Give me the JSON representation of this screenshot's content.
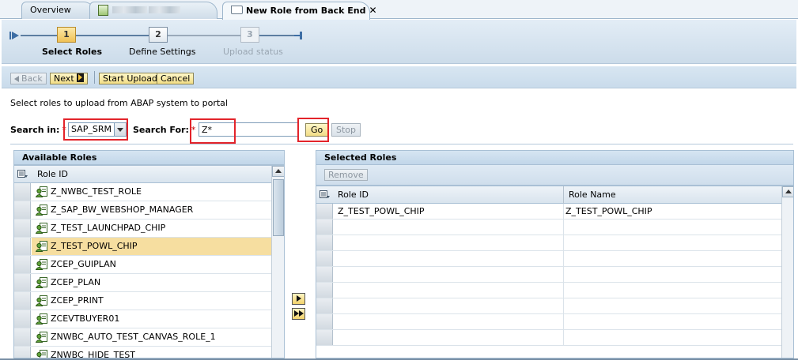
{
  "tabs": [
    {
      "label": "Overview"
    },
    {
      "label": "…"
    },
    {
      "label": "New Role from Back End",
      "close": "✕"
    }
  ],
  "roadmap": {
    "steps": [
      {
        "number": "1",
        "label": "Select Roles",
        "state": "active"
      },
      {
        "number": "2",
        "label": "Define Settings",
        "state": "enabled"
      },
      {
        "number": "3",
        "label": "Upload status",
        "state": "disabled"
      }
    ]
  },
  "toolbar": {
    "back": "Back",
    "next": "Next",
    "start_upload": "Start Upload",
    "cancel": "Cancel"
  },
  "form": {
    "instruction": "Select roles to upload from ABAP system to portal",
    "search_in_label": "Search in:",
    "search_in_value": "SAP_SRM",
    "search_for_label": "Search For:",
    "search_for_value": "Z*",
    "required_mark": "*",
    "go": "Go",
    "stop": "Stop"
  },
  "available_roles": {
    "title": "Available Roles",
    "column": "Role ID",
    "rows": [
      "Z_NWBC_TEST_ROLE",
      "Z_SAP_BW_WEBSHOP_MANAGER",
      "Z_TEST_LAUNCHPAD_CHIP",
      "Z_TEST_POWL_CHIP",
      "ZCEP_GUIPLAN",
      "ZCEP_PLAN",
      "ZCEP_PRINT",
      "ZCEVTBUYER01",
      "ZNWBC_AUTO_TEST_CANVAS_ROLE_1",
      "ZNWBC_HIDE_TEST"
    ],
    "selected_row": "Z_TEST_POWL_CHIP"
  },
  "selected_roles": {
    "title": "Selected Roles",
    "remove": "Remove",
    "columns": [
      "Role ID",
      "Role Name"
    ],
    "rows": [
      [
        "Z_TEST_POWL_CHIP",
        "Z_TEST_POWL_CHIP"
      ]
    ]
  },
  "icons": {
    "roadmap_start": "roadmap-start-icon",
    "roadmap_end": "roadmap-end-icon",
    "role": "role-icon",
    "column_settings": "column-settings-icon",
    "move_one": "move-right-icon",
    "move_all": "move-all-right-icon"
  },
  "colors": {
    "highlight": "#e3242b",
    "selected_row": "#f6dea0",
    "button_face": "#f2dd86"
  }
}
